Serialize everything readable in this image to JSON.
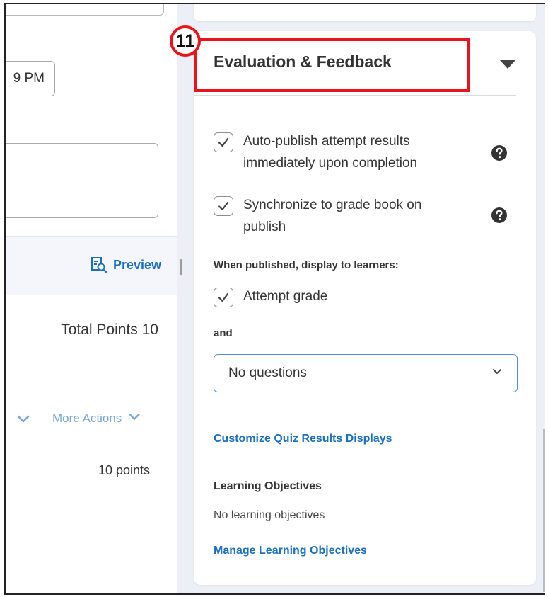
{
  "left_panel": {
    "time_field_value": "9 PM",
    "preview_label": "Preview",
    "total_points": "Total Points 10",
    "more_actions_label": "More Actions",
    "points_value": "10 points"
  },
  "panel": {
    "title": "Evaluation & Feedback",
    "step_number": "11",
    "options": [
      {
        "label": "Auto-publish attempt results immediately upon completion",
        "checked": true
      },
      {
        "label": "Synchronize to grade book on publish",
        "checked": true
      }
    ],
    "display_heading": "When published, display to learners:",
    "attempt_grade_label": "Attempt grade",
    "and_label": "and",
    "questions_select_value": "No questions",
    "customize_link": "Customize Quiz Results Displays",
    "learning_objectives_heading": "Learning Objectives",
    "learning_objectives_status": "No learning objectives",
    "manage_objectives_link": "Manage Learning Objectives"
  },
  "colors": {
    "highlight": "#e8141c",
    "link": "#1c6fbd",
    "select_border": "#4a90d0",
    "background": "#eceff5"
  },
  "icons": [
    "preview-icon",
    "chevron-down-icon",
    "caret-down-icon",
    "help-icon",
    "check-icon"
  ]
}
